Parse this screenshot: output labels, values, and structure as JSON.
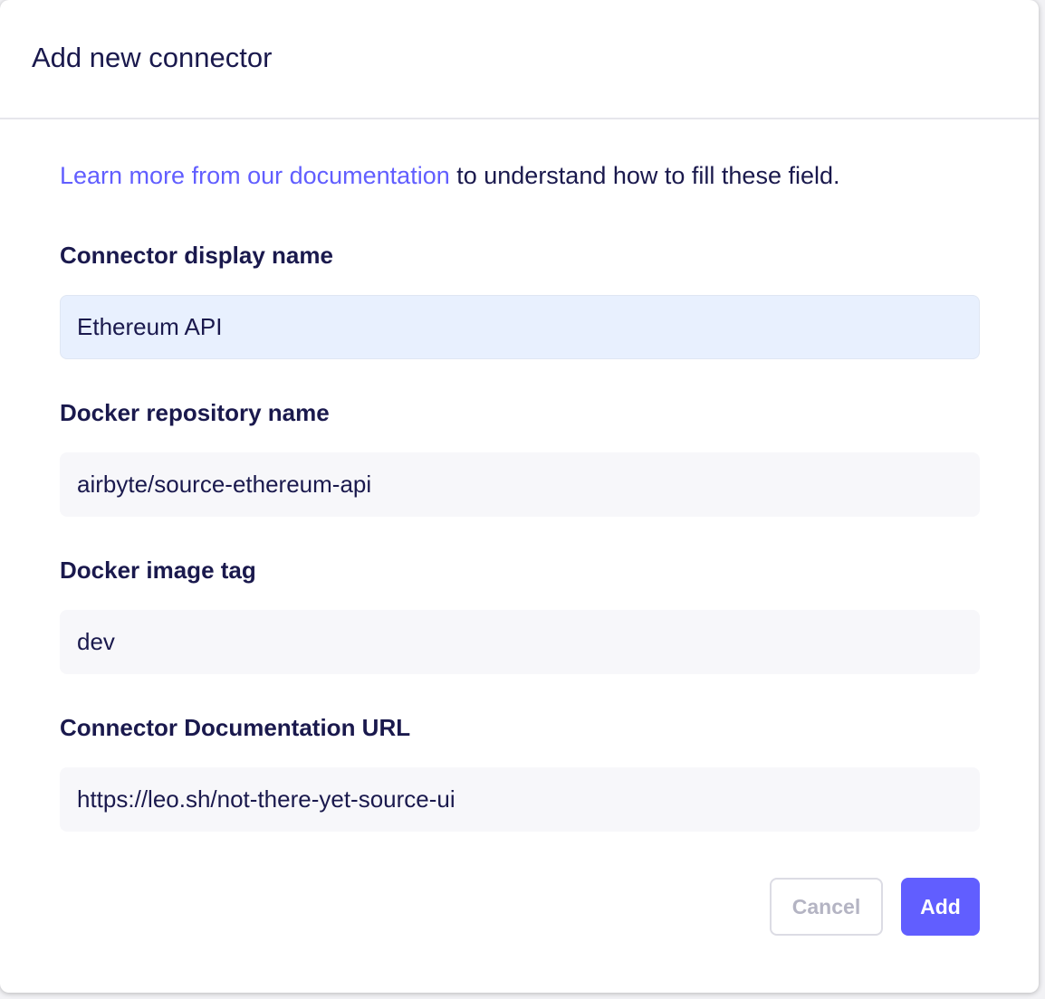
{
  "modal": {
    "title": "Add new connector"
  },
  "intro": {
    "link_text": "Learn more from our documentation",
    "rest_text": " to understand how to fill these field."
  },
  "fields": {
    "display_name": {
      "label": "Connector display name",
      "value": "Ethereum API"
    },
    "docker_repository": {
      "label": "Docker repository name",
      "value": "airbyte/source-ethereum-api"
    },
    "docker_image_tag": {
      "label": "Docker image tag",
      "value": "dev"
    },
    "documentation_url": {
      "label": "Connector Documentation URL",
      "value": "https://leo.sh/not-there-yet-source-ui"
    }
  },
  "actions": {
    "cancel_label": "Cancel",
    "add_label": "Add"
  },
  "colors": {
    "primary": "#615eff",
    "text": "#1a194d",
    "input_background": "#f7f7fa",
    "autofill_background": "#e8f0fe",
    "disabled_text": "#b4b4c3"
  }
}
